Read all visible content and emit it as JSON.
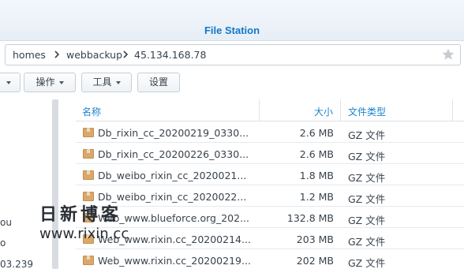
{
  "window": {
    "title": "File Station"
  },
  "path": {
    "segments": [
      "homes",
      "webbackup",
      "45.134.168.78"
    ]
  },
  "toolbar": {
    "action_label": "操作",
    "tools_label": "工具",
    "settings_label": "设置"
  },
  "sidebar": {
    "fragments": [
      "ou",
      "o",
      "03.239"
    ]
  },
  "columns": {
    "name": "名称",
    "size": "大小",
    "type": "文件类型"
  },
  "files": [
    {
      "name": "Db_rixin_cc_20200219_0330...",
      "size": "2.6 MB",
      "type": "GZ 文件"
    },
    {
      "name": "Db_rixin_cc_20200226_0330...",
      "size": "2.6 MB",
      "type": "GZ 文件"
    },
    {
      "name": "Db_weibo_rixin_cc_2020021...",
      "size": "1.8 MB",
      "type": "GZ 文件"
    },
    {
      "name": "Db_weibo_rixin_cc_2020022...",
      "size": "1.2 MB",
      "type": "GZ 文件"
    },
    {
      "name": "Web_www.blueforce.org_202...",
      "size": "132.8 MB",
      "type": "GZ 文件"
    },
    {
      "name": "Web_www.rixin.cc_20200214...",
      "size": "203 MB",
      "type": "GZ 文件"
    },
    {
      "name": "Web_www.rixin.cc_20200219...",
      "size": "202 MB",
      "type": "GZ 文件"
    }
  ],
  "watermark": {
    "cn": "日新博客",
    "url": "www.rixin.cc"
  },
  "colors": {
    "accent": "#1478c8",
    "folder": "#d9a86a"
  }
}
